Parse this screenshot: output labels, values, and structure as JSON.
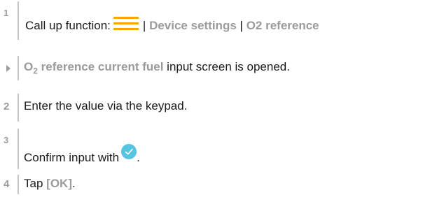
{
  "steps": [
    {
      "number": "1",
      "prefix": "Call up function:",
      "sep1": "|",
      "link1": "Device settings",
      "sep2": "|",
      "link2": "O2 reference"
    },
    {
      "result_pre": "O",
      "result_sub": "2",
      "result_link_post": " reference current fuel",
      "result_text": " input screen is opened."
    },
    {
      "number": "2",
      "text": "Enter the value via the keypad."
    },
    {
      "number": "3",
      "text": "Confirm input with",
      "suffix": "."
    },
    {
      "number": "4",
      "prefix": "Tap",
      "button": "[OK]",
      "suffix": "."
    }
  ],
  "icons": {
    "menu": "hamburger-menu-icon",
    "confirm": "checkmark-circle-icon"
  },
  "colors": {
    "accent_orange": "#f7a700",
    "label_gray": "#9b9b9b",
    "check_blue": "#57c4e2"
  }
}
